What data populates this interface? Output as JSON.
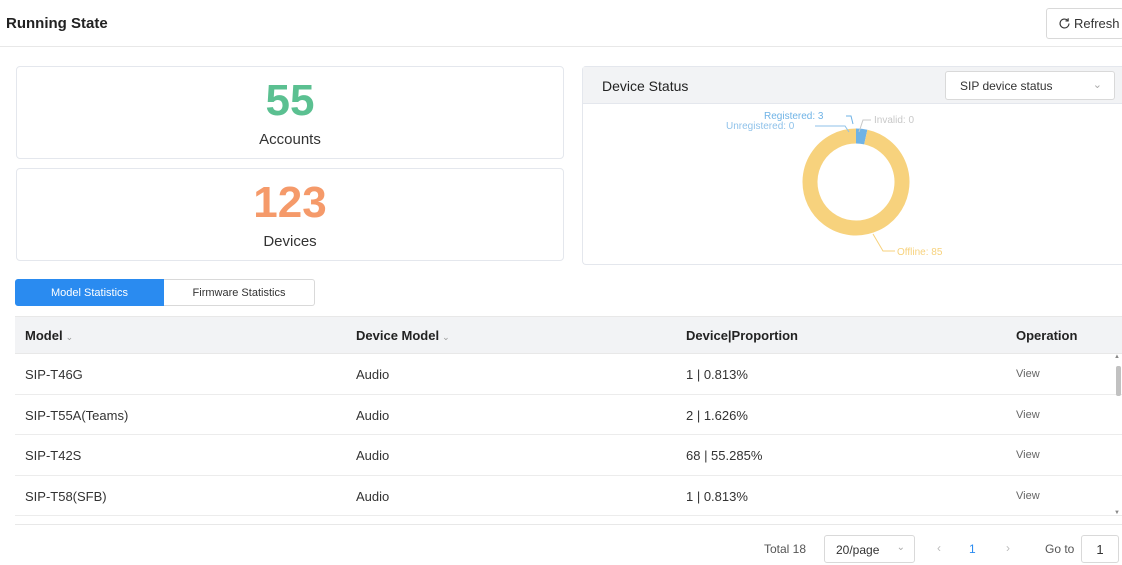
{
  "header": {
    "title": "Running State",
    "refresh_label": "Refresh"
  },
  "cards": {
    "accounts": {
      "value": "55",
      "label": "Accounts",
      "color": "#5bc091"
    },
    "devices": {
      "value": "123",
      "label": "Devices",
      "color": "#f59a6a"
    }
  },
  "device_status": {
    "title": "Device Status",
    "select_value": "SIP device status",
    "legend": {
      "registered": "Registered: 3",
      "unregistered": "Unregistered: 0",
      "invalid": "Invalid: 0",
      "offline": "Offline: 85"
    }
  },
  "chart_data": {
    "type": "pie",
    "categories": [
      "Registered",
      "Unregistered",
      "Invalid",
      "Offline"
    ],
    "values": [
      3,
      0,
      0,
      85
    ],
    "colors": [
      "#6fb3e6",
      "#8fc2ea",
      "#c8c8c8",
      "#f7d27d"
    ]
  },
  "tabs": [
    {
      "label": "Model Statistics",
      "active": true
    },
    {
      "label": "Firmware Statistics",
      "active": false
    }
  ],
  "table": {
    "headers": [
      "Model",
      "Device Model",
      "Device|Proportion",
      "Operation"
    ],
    "rows": [
      {
        "model": "SIP-T46G",
        "device_model": "Audio",
        "proportion": "1 | 0.813%",
        "op": "View"
      },
      {
        "model": "SIP-T55A(Teams)",
        "device_model": "Audio",
        "proportion": "2 | 1.626%",
        "op": "View"
      },
      {
        "model": "SIP-T42S",
        "device_model": "Audio",
        "proportion": "68 | 55.285%",
        "op": "View"
      },
      {
        "model": "SIP-T58(SFB)",
        "device_model": "Audio",
        "proportion": "1 | 0.813%",
        "op": "View"
      }
    ]
  },
  "pagination": {
    "total": "Total 18",
    "page_size": "20/page",
    "current_page": "1",
    "goto_label": "Go to",
    "goto_value": "1"
  },
  "colors": {
    "accent": "#2a8bf0"
  }
}
